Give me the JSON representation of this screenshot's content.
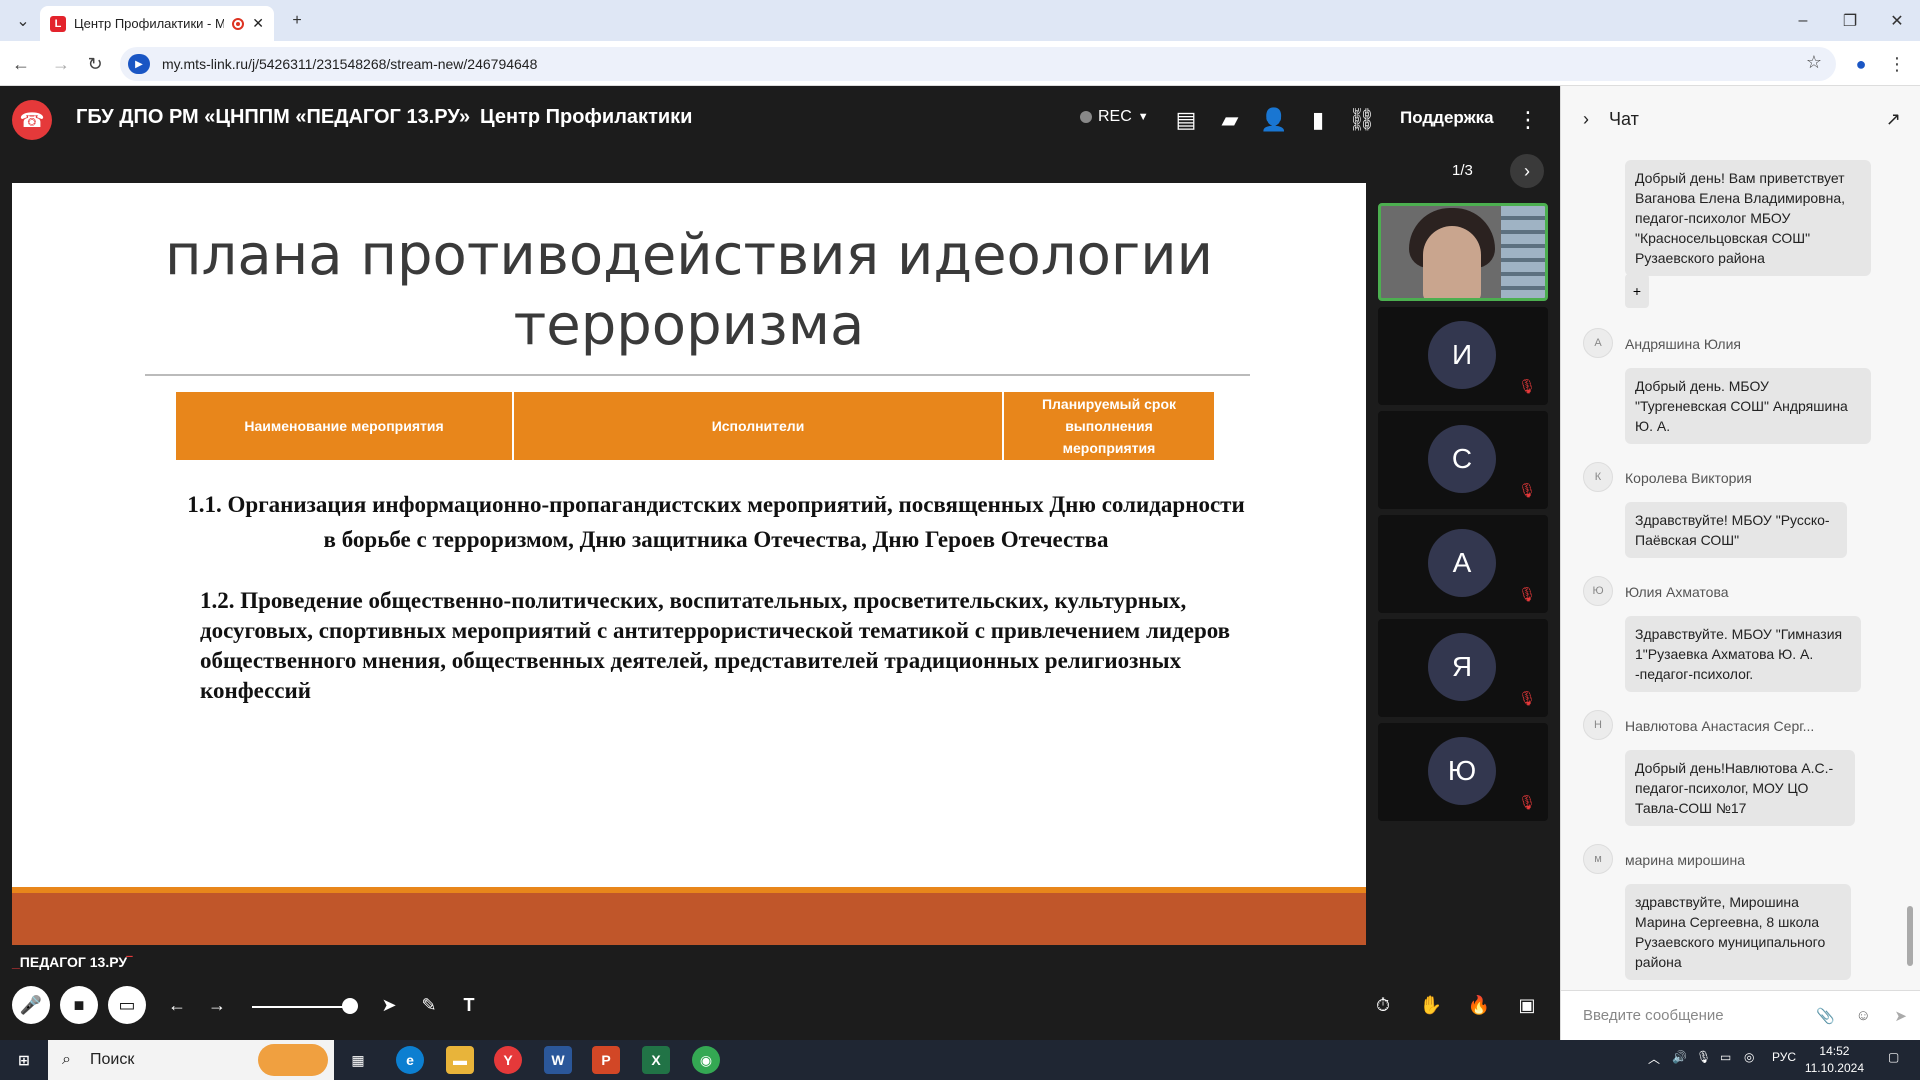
{
  "browser": {
    "tab_title": "Центр Профилактики - МТ",
    "url": "my.mts-link.ru/j/5426311/231548268/stream-new/246794648"
  },
  "app": {
    "org_title": "ГБУ ДПО РМ «ЦНППМ «ПЕДАГОГ 13.РУ»",
    "room_title": "Центр Профилактики",
    "rec_label": "REC",
    "support_label": "Поддержка",
    "pager": "1/3",
    "brand": "ПЕДАГОГ 13.РУ"
  },
  "slide": {
    "title": "плана противодействия идеологии терроризма",
    "table_headers": [
      "Наименование мероприятия",
      "Исполнители",
      "Планируемый срок выполнения мероприятия"
    ],
    "item1": "1.1. Организация информационно-пропагандистских мероприятий, посвященных Дню солидарности в борьбе с терроризмом, Дню защитника Отечества, Дню Героев Отечества",
    "item2": "1.2. Проведение общественно-политических, воспитательных, просветительских, культурных, досуговых, спортивных мероприятий с антитеррористической тематикой с привлечением лидеров общественного мнения, общественных деятелей, представителей традиционных религиозных конфессий"
  },
  "participants": [
    "И",
    "С",
    "А",
    "Я",
    "Ю"
  ],
  "chat": {
    "title": "Чат",
    "messages": [
      {
        "author": "",
        "initial": "",
        "text": "Добрый день! Вам приветствует Ваганова Елена Владимировна, педагог-психолог МБОУ \"Красносельцовская СОШ\" Рузаевского района"
      },
      {
        "author": "Андряшина Юлия",
        "initial": "А",
        "text": "Добрый день. МБОУ \"Тургеневская СОШ\" Андряшина Ю. А."
      },
      {
        "author": "Королева Виктория",
        "initial": "К",
        "text": "Здравствуйте! МБОУ \"Русско-Паёвская СОШ\""
      },
      {
        "author": "Юлия Ахматова",
        "initial": "Ю",
        "text": "Здравствуйте. МБОУ \"Гимназия 1\"Рузаевка Ахматова Ю. А. -педагог-психолог."
      },
      {
        "author": "Навлютова Анастасия Серг...",
        "initial": "Н",
        "text": "Добрый день!Навлютова А.С.-педагог-психолог, МОУ ЦО Тавла-СОШ №17"
      },
      {
        "author": "марина мирошина",
        "initial": "м",
        "text": "здравствуйте, Мирошина Марина Сергеевна, 8 школа Рузаевского муниципального района"
      }
    ],
    "plus": "+",
    "input_placeholder": "Введите сообщение"
  },
  "taskbar": {
    "search_label": "Поиск",
    "lang": "РУС",
    "time": "14:52",
    "date": "11.10.2024"
  }
}
